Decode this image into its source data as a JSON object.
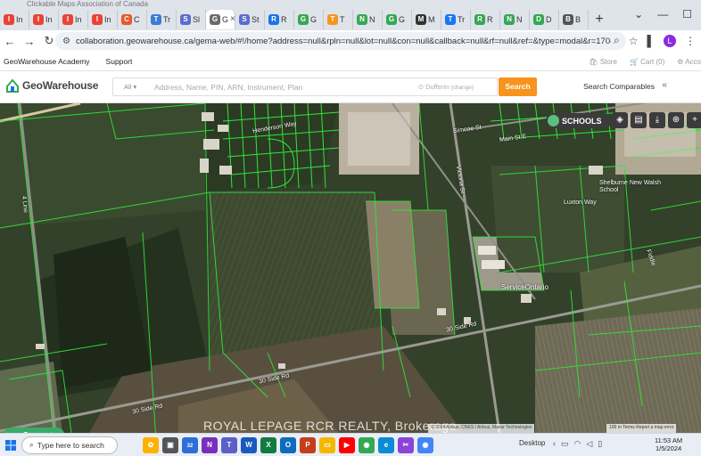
{
  "browser": {
    "title_ghost": "Clickable Maps Association of Canada",
    "tabs": [
      {
        "label": "In",
        "icon": "gmail-icon",
        "color": "#ea4335"
      },
      {
        "label": "In",
        "icon": "gmail-icon",
        "color": "#ea4335"
      },
      {
        "label": "In",
        "icon": "gmail-icon",
        "color": "#ea4335"
      },
      {
        "label": "In",
        "icon": "gmail-icon",
        "color": "#ea4335"
      },
      {
        "label": "C",
        "icon": "c-icon",
        "color": "#e8582c"
      },
      {
        "label": "Tr",
        "icon": "wave-icon",
        "color": "#3a7bd5"
      },
      {
        "label": "Sl",
        "icon": "globe-icon",
        "color": "#5b6dcd"
      },
      {
        "label": "G",
        "icon": "gw-icon",
        "color": "#6b6b6b",
        "active": true
      },
      {
        "label": "St",
        "icon": "globe-icon",
        "color": "#5b6dcd"
      },
      {
        "label": "R",
        "icon": "r-icon",
        "color": "#1a73e8"
      },
      {
        "label": "G",
        "icon": "gw-icon",
        "color": "#35a853"
      },
      {
        "label": "T",
        "icon": "triangle-icon",
        "color": "#f7941d"
      },
      {
        "label": "N",
        "icon": "check-icon",
        "color": "#35a853"
      },
      {
        "label": "G",
        "icon": "gw-icon",
        "color": "#35a853"
      },
      {
        "label": "M",
        "icon": "m-icon",
        "color": "#333333"
      },
      {
        "label": "Tr",
        "icon": "facebook-icon",
        "color": "#1877f2"
      },
      {
        "label": "R",
        "icon": "gw-icon",
        "color": "#35a853"
      },
      {
        "label": "N",
        "icon": "check-icon",
        "color": "#35a853"
      },
      {
        "label": "D",
        "icon": "maps-pin-icon",
        "color": "#34a853"
      },
      {
        "label": "B",
        "icon": "search-icon",
        "color": "#555555"
      }
    ],
    "url": "collaboration.geowarehouse.ca/gema-web/#!/home?address=null&rpln=null&lot=null&con=null&callback=null&rf=null&ref=&type=modal&r=1704471681589",
    "avatar_letter": "L"
  },
  "site_nav": {
    "academy": "GeoWarehouse Academy",
    "support": "Support",
    "store": "Store",
    "cart": "Cart (0)",
    "account": "Acco"
  },
  "header": {
    "logo": "GeoWarehouse",
    "filter": "All",
    "search_placeholder": "Address, Name, PIN, ARN, Instrument, Plan",
    "municipality": "Dufferin",
    "municipality_action": "(change)",
    "search_button": "Search",
    "comparables": "Search Comparables"
  },
  "map": {
    "labels": {
      "henderson": "Henderson Way",
      "main_st_e": "Main St E",
      "simcoe": "Simcoe St",
      "victoria": "Victoria St",
      "luxton": "Luxton Way",
      "shelburne_school": "Shelburne New Walsh School",
      "service_ontario": "ServiceOntario",
      "side_rd_a": "30 Side Rd",
      "side_rd_b": "30 Side Rd",
      "side_rd_c": "30 Side Rd",
      "line_4": "4 Line",
      "fiddle": "Fiddle"
    },
    "schools_button": "SCHOOLS",
    "watermark": "ROYAL LEPAGE RCR REALTY, Brokerage",
    "attribution": "© 2024 Airbus, CNES / Airbus, Maxar Technologies",
    "scale": "100 m  Terms  Report a map error",
    "support_button": "Support"
  },
  "taskbar": {
    "search_placeholder": "Type here to search",
    "desktop": "Desktop",
    "time": "11:53 AM",
    "date": "1/5/2024",
    "mail_badge": "32"
  }
}
